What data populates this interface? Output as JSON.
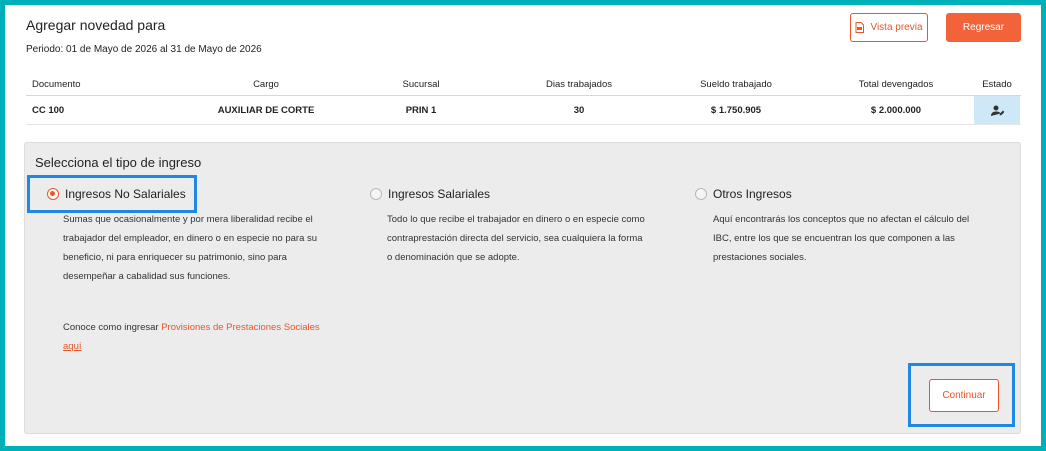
{
  "header": {
    "title": "Agregar novedad para",
    "periodo": "Periodo: 01 de Mayo de 2026 al 31 de Mayo de 2026",
    "preview_label": "Vista previa",
    "back_label": "Regresar"
  },
  "table": {
    "columns": [
      "Documento",
      "Cargo",
      "Sucursal",
      "Dias trabajados",
      "Sueldo trabajado",
      "Total devengados",
      "Estado"
    ],
    "row": {
      "documento": "CC 100",
      "cargo": "AUXILIAR DE CORTE",
      "sucursal": "PRIN 1",
      "dias": "30",
      "sueldo": "$ 1.750.905",
      "total": "$ 2.000.000"
    }
  },
  "panel": {
    "title": "Selecciona el tipo de ingreso",
    "options": [
      {
        "label": "Ingresos No Salariales",
        "selected": true,
        "description": [
          "Sumas que ocasionalmente y por mera liberalidad recibe el",
          "trabajador del empleador, en dinero o en especie no para su",
          "beneficio, ni para enriquecer su patrimonio, sino para",
          "desempeñar a cabalidad sus funciones."
        ]
      },
      {
        "label": "Ingresos Salariales",
        "selected": false,
        "description": [
          "Todo lo que recibe el trabajador en dinero o en especie como",
          "contraprestación directa del servicio, sea cualquiera la forma",
          "o denominación que se adopte."
        ]
      },
      {
        "label": "Otros Ingresos",
        "selected": false,
        "description": [
          "Aquí encontrarás los conceptos que no afectan el cálculo del",
          "IBC, entre los que se encuentran los que componen a las",
          "prestaciones sociales."
        ]
      }
    ],
    "note_prefix": "Conoce como ingresar",
    "note_link": "Provisiones de Prestaciones Sociales",
    "note_link2": "aquí",
    "continue_label": "Continuar"
  },
  "colors": {
    "accent": "#f26339",
    "frame": "#00b0b9",
    "highlight": "#1e88e5",
    "estado_bg": "#cfe8f7"
  }
}
